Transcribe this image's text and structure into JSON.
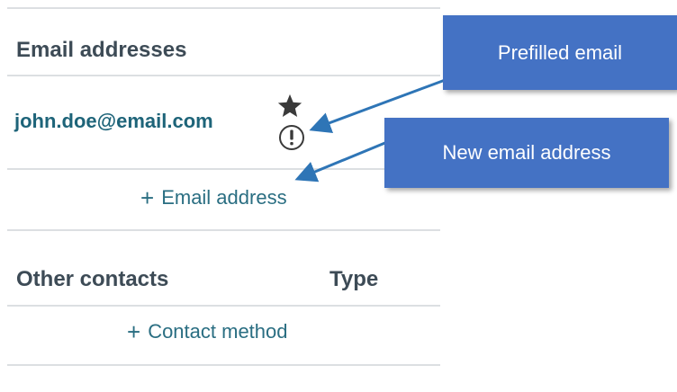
{
  "email_section": {
    "title": "Email addresses",
    "primary_email": "john.doe@email.com",
    "add_email_label": "Email address",
    "star_icon": "star-icon",
    "alert_icon": "alert-circle-icon"
  },
  "contacts_section": {
    "title": "Other contacts",
    "type_header": "Type",
    "add_contact_label": "Contact method",
    "plus_icon": "plus-icon"
  },
  "callouts": {
    "prefilled": "Prefilled email",
    "new_email": "New email address"
  },
  "colors": {
    "heading": "#3d4b56",
    "link": "#1e6479",
    "callout_bg": "#4472c4",
    "arrow": "#2e75b6",
    "divider": "#dcdfe2"
  }
}
